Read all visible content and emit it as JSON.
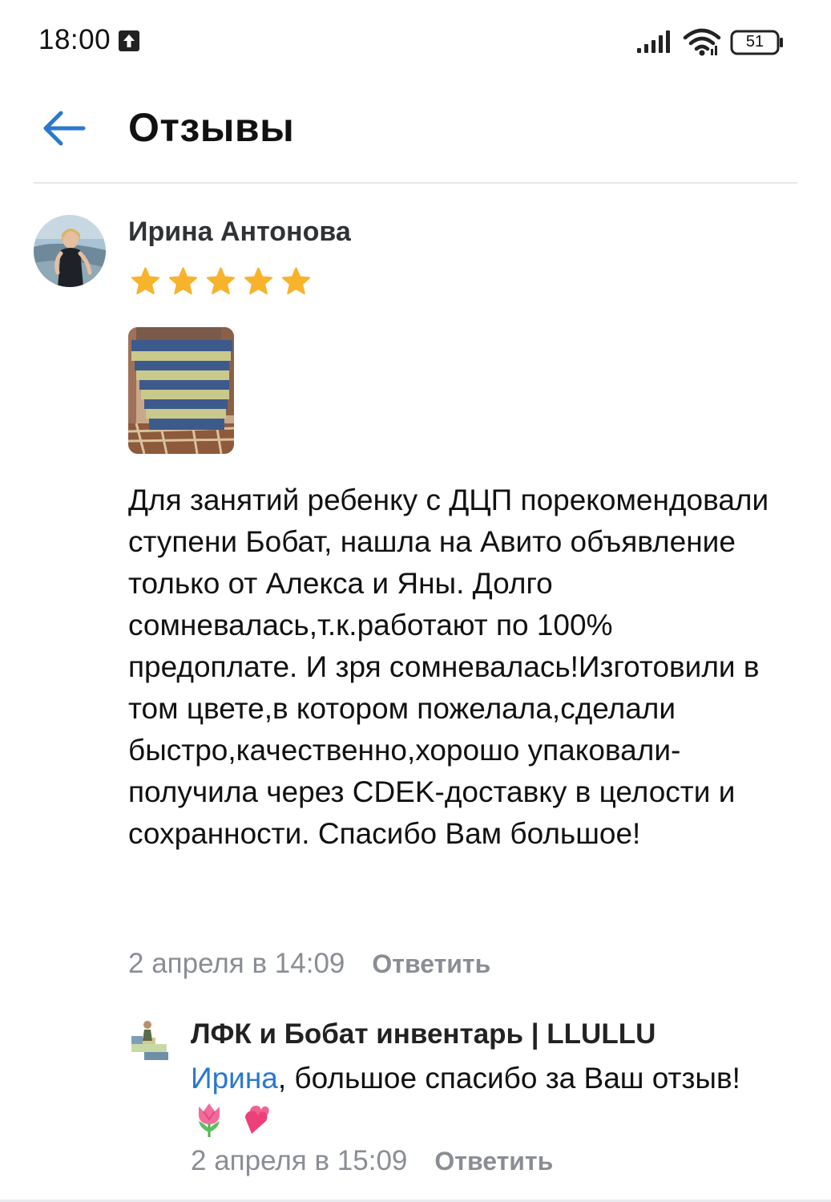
{
  "status_bar": {
    "time": "18:00",
    "battery": "51",
    "icons": [
      "upload-arrow-icon",
      "cell-signal-icon",
      "wifi-icon",
      "battery-icon"
    ]
  },
  "header": {
    "title": "Отзывы",
    "back_icon": "back-arrow-icon"
  },
  "review": {
    "author": "Ирина Антонова",
    "rating": 5,
    "star_color": "#f7b32b",
    "text": "Для занятий ребенку с ДЦП порекомендовали ступени Бобат, нашла на Авито объявление только от Алекса и Яны. Долго сомневалась,т.к.работают по 100% предоплате. И зря сомневалась!Изготовили в том цвете,в котором пожелала,сделали быстро,качественно,хорошо упаковали-получила через CDEK-доставку в целости и сохранности. Спасибо Вам большое!",
    "date": "2 апреля в 14:09",
    "reply_label": "Ответить"
  },
  "response": {
    "author": "ЛФК и Бобат инвентарь | LLULLU",
    "mention": "Ирина",
    "text": ", большое спасибо за Ваш отзыв!",
    "emojis": [
      "tulip-icon",
      "two-hearts-icon"
    ],
    "date": "2 апреля в 15:09",
    "reply_label": "Ответить"
  },
  "colors": {
    "link": "#2a78cf",
    "meta": "#8a8e94",
    "divider": "#e4e6ea"
  }
}
